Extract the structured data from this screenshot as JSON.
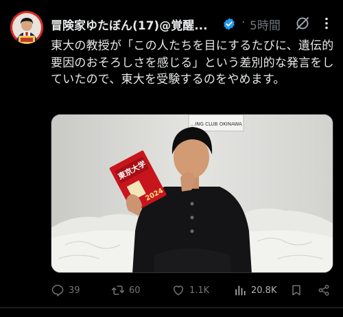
{
  "post": {
    "author": "冒険家ゆたぼん(17)@覚醒...",
    "dot": "·",
    "time": "5時間",
    "text": "東大の教授が「この人たちを目にするたびに、遺伝的要因のおそろしさを感じる」という差別的な発言をしていたので、東大を受験するのをやめます。",
    "media": {
      "sign_text": "…ING CLUB OKINAWA",
      "book_spine": "東京大学",
      "book_year": "2024"
    },
    "actions": {
      "replies": "39",
      "reposts": "60",
      "likes": "1.1K",
      "views": "20.8K"
    }
  },
  "colors": {
    "background": "#000000",
    "text": "#e7e9ea",
    "muted": "#71767b",
    "verified": "#1d9bf0",
    "avatar": "#d92b22"
  },
  "icons": {
    "verified": "verified-badge-icon",
    "grok": "grok-icon",
    "more": "more-vertical-icon",
    "reply": "reply-icon",
    "repost": "repost-icon",
    "like": "heart-icon",
    "views": "views-icon",
    "bookmark": "bookmark-icon",
    "share": "share-icon"
  }
}
